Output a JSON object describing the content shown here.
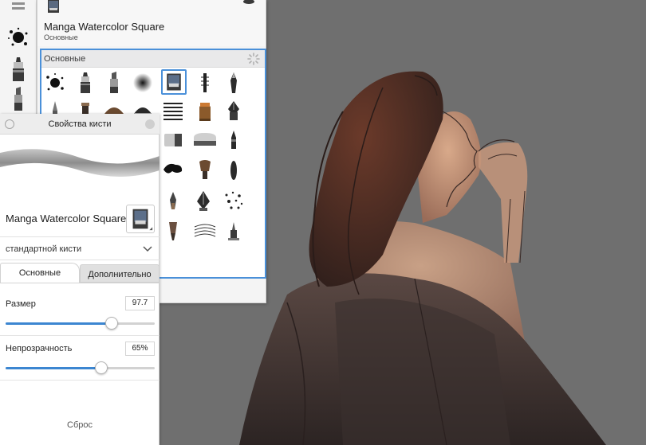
{
  "library": {
    "title": "Manga Watercolor Square",
    "subtitle": "Основные",
    "set_header": "Основные"
  },
  "properties": {
    "title": "Свойства кисти",
    "brush_name": "Manga Watercolor Square",
    "preset": "стандартной кисти",
    "tabs": {
      "basic": "Основные",
      "advanced": "Дополнительно",
      "active": "basic"
    },
    "size": {
      "label": "Размер",
      "value": "97.7",
      "level": 0.71
    },
    "opacity": {
      "label": "Непрозрачность",
      "value": "65%",
      "level": 0.64
    },
    "reset_label": "Сброс"
  },
  "colors": {
    "accent": "#4a90d9",
    "canvas": "#6f6f6f",
    "panel": "#f4f4f4"
  },
  "brush_grid": [
    "ink-splatter-brush",
    "marker-brush",
    "chisel-marker-brush",
    "airbrush-soft-brush",
    "manga-watercolor-square-brush",
    "texture-stick-brush",
    "ink-pen-brush",
    "pencil-brush",
    "flat-brush",
    "fan-brush",
    "dome-stamp-brush",
    "hatching-lines-brush",
    "paint-pot-brush",
    "fountain-pen-brush",
    "eraser-brush",
    "broad-eraser-brush",
    "felt-tip-brush",
    "blot-brush",
    "bristle-brush",
    "dark-stroke-brush",
    "nib-brush",
    "calligraphy-nib-brush",
    "scatter-dots-brush",
    "splay-brush",
    "dry-brush",
    "stamp-pen-brush"
  ]
}
